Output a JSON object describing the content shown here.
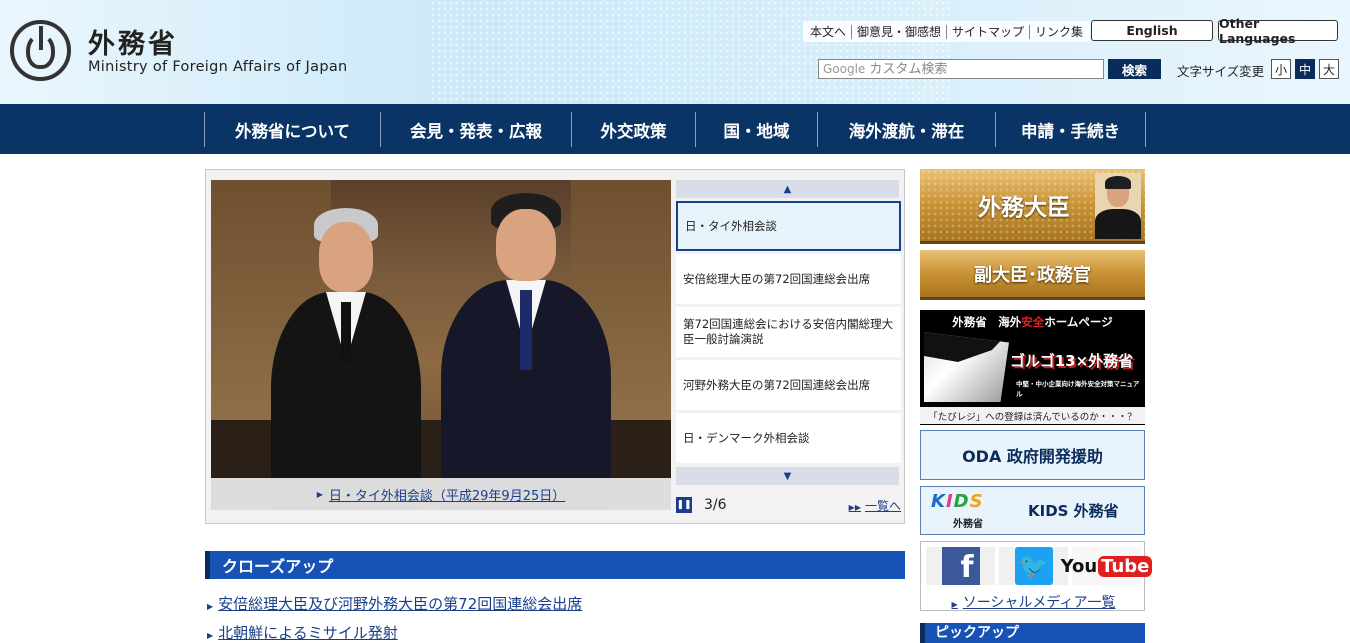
{
  "header": {
    "logo_jp": "外務省",
    "logo_en": "Ministry of Foreign Affairs of Japan",
    "util_links": [
      "本文へ",
      "御意見・御感想",
      "サイトマップ",
      "リンク集"
    ],
    "english_label": "English",
    "other_languages_label": "Other Languages",
    "search_google": "Google",
    "search_placeholder": "カスタム検索",
    "search_button": "検索",
    "font_size_label": "文字サイズ変更",
    "font_sizes": [
      "小",
      "中",
      "大"
    ],
    "font_size_selected": "中"
  },
  "nav": {
    "items": [
      "外務省について",
      "会見・発表・広報",
      "外交政策",
      "国・地域",
      "海外渡航・滞在",
      "申請・手続き"
    ]
  },
  "carousel": {
    "caption": "日・タイ外相会談（平成29年9月25日）",
    "items": [
      "日・タイ外相会談",
      "安倍総理大臣の第72回国連総会出席",
      "第72回国連総会における安倍内閣総理大臣一般討論演説",
      "河野外務大臣の第72回国連総会出席",
      "日・デンマーク外相会談"
    ],
    "active_index": 0,
    "counter": "3/6",
    "all_link": "一覧へ",
    "up_icon": "▲",
    "down_icon": "▼",
    "pause_icon": "❚❚"
  },
  "closeup": {
    "title": "クローズアップ",
    "items": [
      "安倍総理大臣及び河野外務大臣の第72回国連総会出席",
      "北朝鮮によるミサイル発射"
    ]
  },
  "sidebar": {
    "minister": "外務大臣",
    "vice_minister": "副大臣･政務官",
    "safety_title_a": "外務省　海外",
    "safety_title_red": "安全",
    "safety_title_b": "ホームページ",
    "safety_big": "ゴルゴ13×外務省",
    "safety_sub": "中堅・中小企業向け海外安全対策マニュアル",
    "safety_bottom": "「たびレジ」への登録は済んでいるのか・・・？",
    "oda": "ODA 政府開発援助",
    "kids_logo": [
      "K",
      "I",
      "D",
      "S"
    ],
    "kids_sub": "外務省",
    "kids": "KIDS 外務省",
    "social": {
      "facebook": "f",
      "twitter": "🐦",
      "youtube_a": "You",
      "youtube_b": "Tube",
      "link": "ソーシャルメディア一覧"
    },
    "pickup": "ピックアップ"
  }
}
